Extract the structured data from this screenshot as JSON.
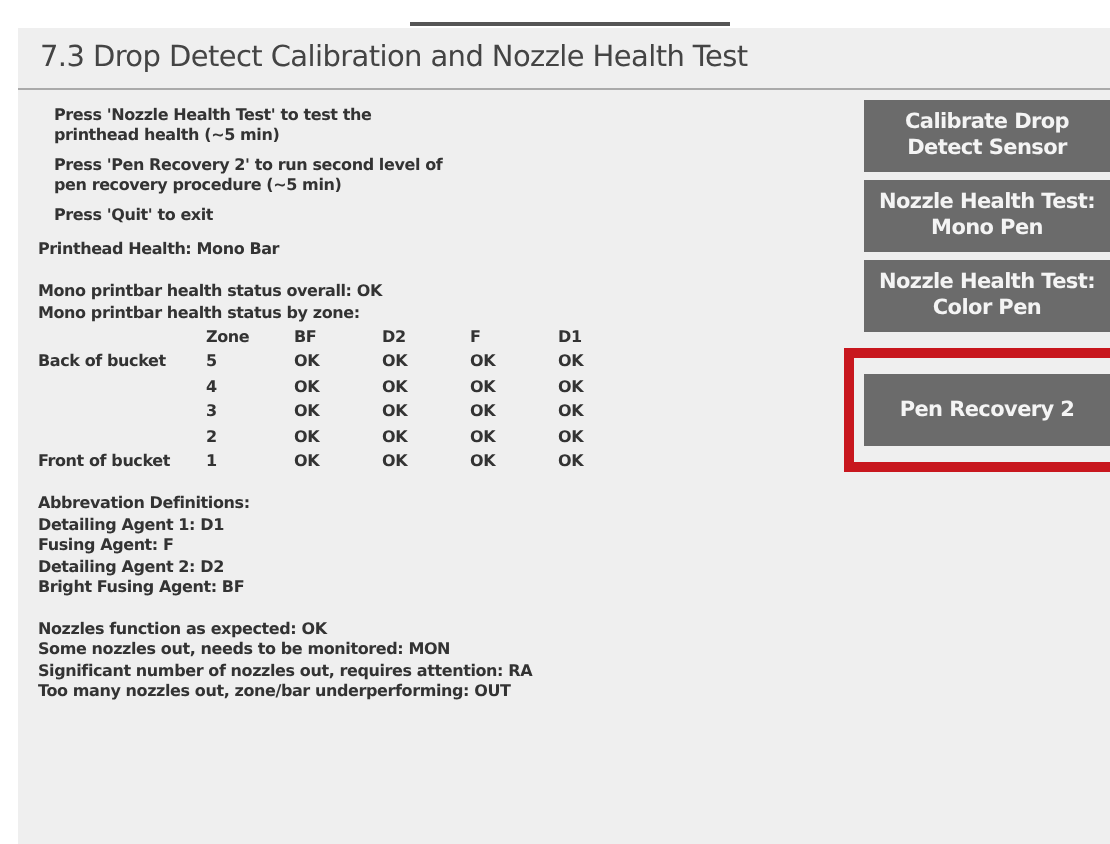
{
  "header": {
    "title": "7.3 Drop Detect Calibration and Nozzle Health Test"
  },
  "instructions": [
    "Press 'Nozzle Health Test' to test the printhead health (~5 min)",
    "Press 'Pen Recovery 2' to run second level of pen recovery procedure (~5 min)",
    "Press 'Quit' to exit"
  ],
  "section_title": "Printhead Health: Mono Bar",
  "status_lines": [
    "Mono printbar health status overall: OK",
    "Mono printbar health status by zone:"
  ],
  "table": {
    "columns": [
      "",
      "Zone",
      "BF",
      "D2",
      "F",
      "D1"
    ],
    "rows": [
      [
        "Back of bucket",
        "5",
        "OK",
        "OK",
        "OK",
        "OK"
      ],
      [
        "",
        "4",
        "OK",
        "OK",
        "OK",
        "OK"
      ],
      [
        "",
        "3",
        "OK",
        "OK",
        "OK",
        "OK"
      ],
      [
        "",
        "2",
        "OK",
        "OK",
        "OK",
        "OK"
      ],
      [
        "Front of bucket",
        "1",
        "OK",
        "OK",
        "OK",
        "OK"
      ]
    ]
  },
  "abbreviations": [
    "Abbrevation Definitions:",
    "Detailing Agent 1: D1",
    "Fusing Agent: F",
    "Detailing Agent 2: D2",
    "Bright Fusing Agent: BF"
  ],
  "legend": [
    "Nozzles function as expected: OK",
    "Some nozzles out, needs to be monitored: MON",
    "Significant number of nozzles out, requires attention: RA",
    "Too many nozzles out, zone/bar underperforming: OUT"
  ],
  "buttons": [
    {
      "label": "Calibrate Drop Detect Sensor",
      "highlighted": false
    },
    {
      "label": "Nozzle Health Test: Mono Pen",
      "highlighted": false
    },
    {
      "label": "Nozzle Health Test: Color Pen",
      "highlighted": false
    },
    {
      "label": "Pen Recovery 2",
      "highlighted": true
    }
  ]
}
